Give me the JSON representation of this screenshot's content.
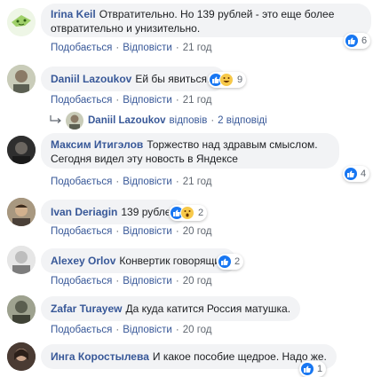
{
  "actions": {
    "like": "Подобається",
    "reply": "Відповісти",
    "dot": "·"
  },
  "comments": [
    {
      "author": "Irina Keil",
      "text": "Отвратительно. Но 139 рублей - это еще более отвратительно и унизительно.",
      "time": "21 год",
      "reactions": "6"
    },
    {
      "author": "Daniil Lazoukov",
      "text": "Ей бы явиться...",
      "time": "21 год",
      "reactions": "9"
    },
    {
      "author": "Максим Итигэлов",
      "text": "Торжество над здравым смыслом. Сегодня видел эту новость в Яндексе",
      "time": "21 год",
      "reactions": "4"
    },
    {
      "author": "Ivan Deriagin",
      "text": "139 рублей",
      "time": "20 год",
      "reactions": "2"
    },
    {
      "author": "Alexey Orlov",
      "text": "Конвертик говорящий",
      "time": "20 год",
      "reactions": "2"
    },
    {
      "author": "Zafar Turayew",
      "text": "Да куда катится Россия матушка.",
      "time": "20 год"
    },
    {
      "author": "Инга Коростылева",
      "text": "И какое пособие щедрое. Надо же.",
      "reactions": "1"
    }
  ],
  "replies": {
    "author": "Daniil Lazoukov",
    "verb": "відповів",
    "count": "2 відповіді"
  },
  "colors": {
    "link": "#385898",
    "bubble": "#f2f3f5",
    "meta": "#606770",
    "like": "#1877f2"
  }
}
